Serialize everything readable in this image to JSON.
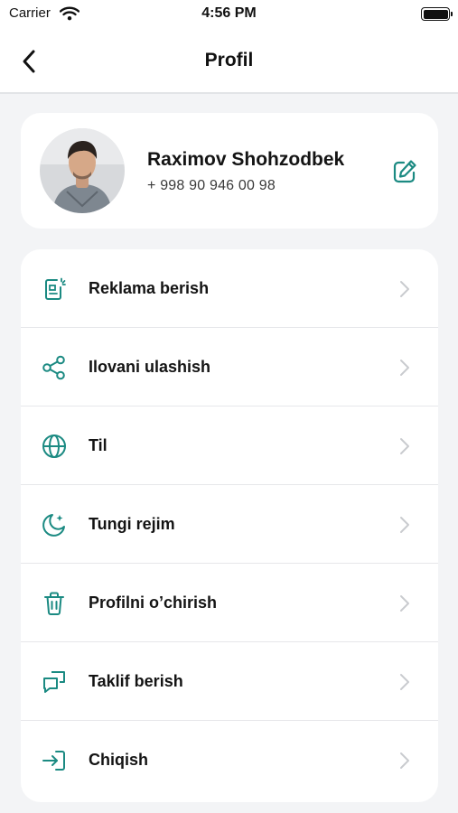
{
  "status_bar": {
    "carrier": "Carrier",
    "time": "4:56 PM"
  },
  "header": {
    "title": "Profil"
  },
  "profile": {
    "name": "Raximov Shohzodbek",
    "phone": "+ 998 90 946 00 98"
  },
  "menu": [
    {
      "label": "Reklama berish",
      "icon": "advertise-icon"
    },
    {
      "label": "Ilovani ulashish",
      "icon": "share-icon"
    },
    {
      "label": "Til",
      "icon": "globe-icon"
    },
    {
      "label": "Tungi rejim",
      "icon": "moon-icon"
    },
    {
      "label": "Profilni o’chirish",
      "icon": "trash-icon"
    },
    {
      "label": "Taklif berish",
      "icon": "feedback-icon"
    },
    {
      "label": "Chiqish",
      "icon": "logout-icon"
    }
  ],
  "colors": {
    "accent": "#1b8a82",
    "background": "#f3f4f6",
    "chevron": "#c9cbcf"
  }
}
